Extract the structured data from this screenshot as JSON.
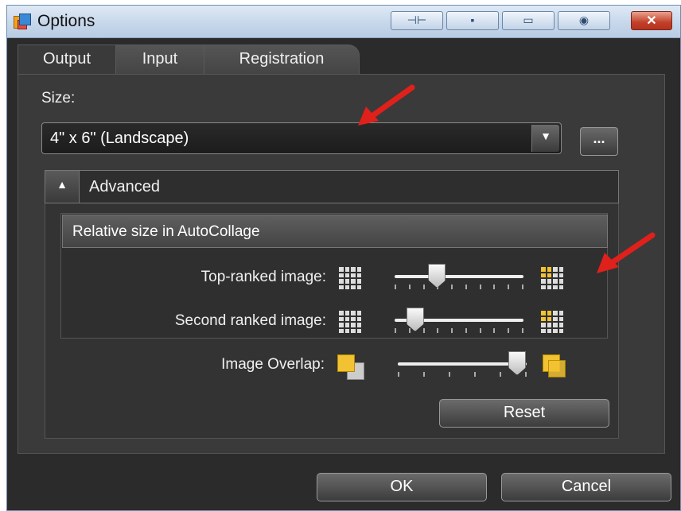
{
  "window": {
    "title": "Options",
    "title_buttons": [
      "pin",
      "minimize",
      "restore",
      "help"
    ],
    "close_glyph": "✕"
  },
  "tabs": [
    {
      "label": "Output",
      "active": true
    },
    {
      "label": "Input",
      "active": false
    },
    {
      "label": "Registration",
      "active": false
    }
  ],
  "size": {
    "label": "Size:",
    "selected": "4\" x 6\" (Landscape)",
    "more_label": "..."
  },
  "advanced": {
    "label": "Advanced",
    "expanded": true,
    "relative_size": {
      "header": "Relative size in AutoCollage",
      "top_ranked": {
        "label": "Top-ranked image:",
        "level": 0.3
      },
      "second_ranked": {
        "label": "Second ranked image:",
        "level": 0.1
      }
    },
    "image_overlap": {
      "label": "Image Overlap:",
      "level": 1.0
    },
    "reset_label": "Reset"
  },
  "footer": {
    "ok_label": "OK",
    "cancel_label": "Cancel"
  },
  "colors": {
    "background": "#2b2b2b",
    "panel": "#3a3a3a",
    "accent_gold": "#f2c232",
    "arrow_red": "#e0201a"
  }
}
